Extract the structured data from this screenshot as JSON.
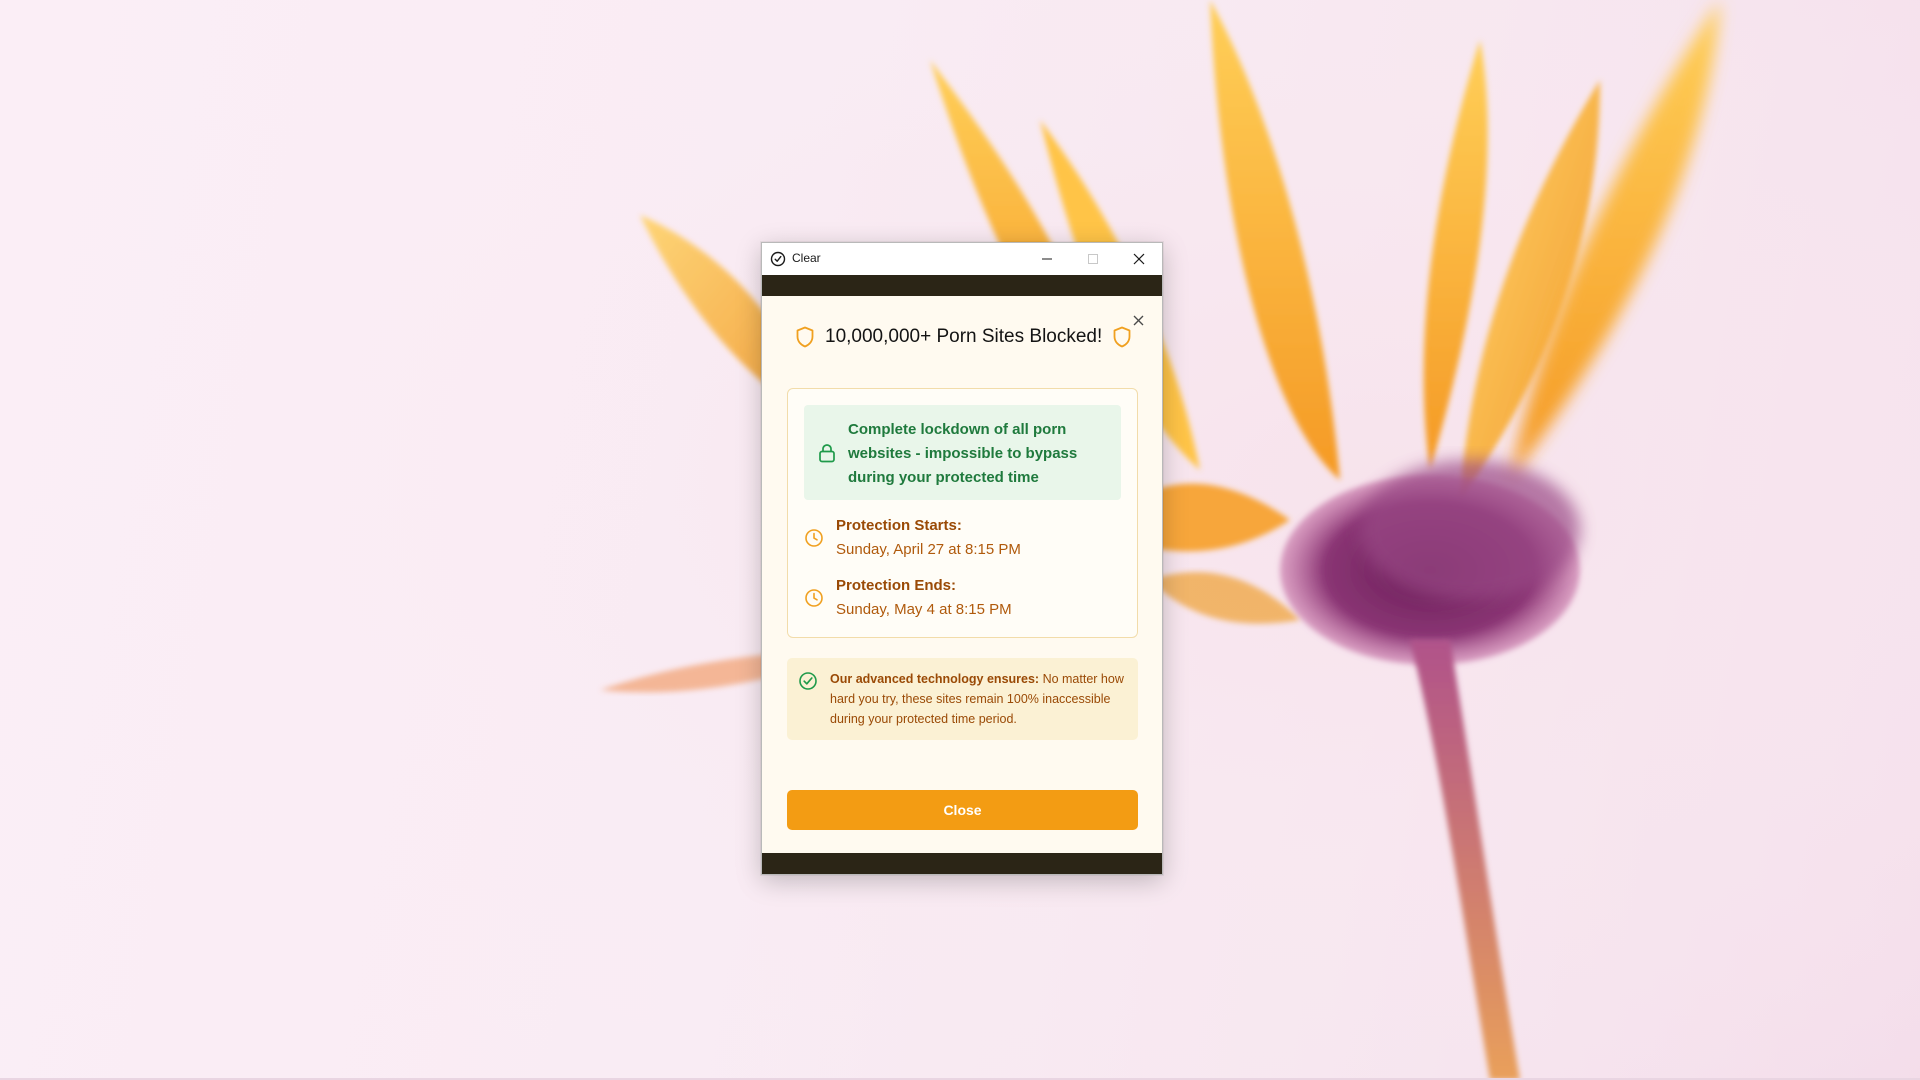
{
  "window": {
    "title": "Clear",
    "minimize_icon": "minimize-icon",
    "maximize_icon": "maximize-icon",
    "close_icon": "close-icon"
  },
  "dialog": {
    "heading": "10,000,000+ Porn Sites Blocked!",
    "heading_icon": "shield-icon",
    "lockdown_text": "Complete lockdown of all porn websites - impossible to bypass during your protected time",
    "protection_start": {
      "label": "Protection Starts:",
      "value": "Sunday, April 27 at 8:15 PM"
    },
    "protection_end": {
      "label": "Protection Ends:",
      "value": "Sunday, May 4 at 8:15 PM"
    },
    "note": {
      "strong": "Our advanced technology ensures:",
      "text": " No matter how hard you try, these sites remain 100% inaccessible during your protected time period."
    },
    "close_button_label": "Close"
  },
  "colors": {
    "accent": "#f39c13",
    "success_green": "#1f7a3d",
    "warning_brown": "#9a4a06",
    "dark_bar": "#2b2516"
  }
}
